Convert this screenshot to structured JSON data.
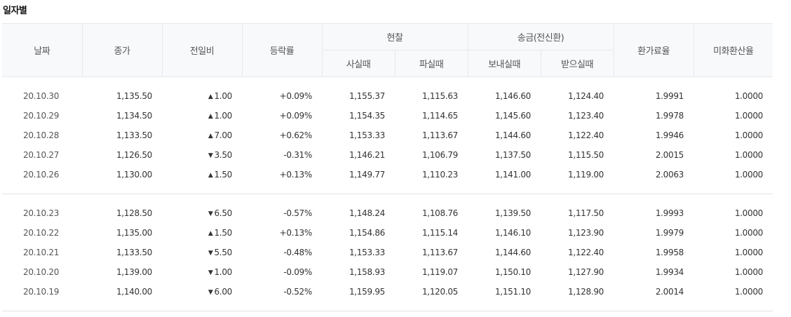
{
  "title": "일자별",
  "headers": {
    "date": "날짜",
    "close": "종가",
    "change": "전일비",
    "rate": "등락률",
    "cash": "현찰",
    "cash_buy": "사실때",
    "cash_sell": "파실때",
    "wire": "송금(전신환)",
    "wire_send": "보내실때",
    "wire_recv": "받으실때",
    "exchange_fee_rate": "환가료율",
    "usd_conversion_rate": "미화환산율"
  },
  "colors": {
    "up": "#e0242a",
    "down": "#1f57c3",
    "header_bg": "#f8f9fb"
  },
  "icons": {
    "up": "triangle-up-icon",
    "down": "triangle-down-icon"
  },
  "rows": [
    {
      "date": "20.10.30",
      "close": "1,135.50",
      "dir": "up",
      "arrow": "▲",
      "change": "1.00",
      "rate": "+0.09%",
      "cash_buy": "1,155.37",
      "cash_sell": "1,115.63",
      "wire_send": "1,146.60",
      "wire_recv": "1,124.40",
      "fee": "1.9991",
      "usd": "1.0000"
    },
    {
      "date": "20.10.29",
      "close": "1,134.50",
      "dir": "up",
      "arrow": "▲",
      "change": "1.00",
      "rate": "+0.09%",
      "cash_buy": "1,154.35",
      "cash_sell": "1,114.65",
      "wire_send": "1,145.60",
      "wire_recv": "1,123.40",
      "fee": "1.9978",
      "usd": "1.0000"
    },
    {
      "date": "20.10.28",
      "close": "1,133.50",
      "dir": "up",
      "arrow": "▲",
      "change": "7.00",
      "rate": "+0.62%",
      "cash_buy": "1,153.33",
      "cash_sell": "1,113.67",
      "wire_send": "1,144.60",
      "wire_recv": "1,122.40",
      "fee": "1.9946",
      "usd": "1.0000"
    },
    {
      "date": "20.10.27",
      "close": "1,126.50",
      "dir": "down",
      "arrow": "▼",
      "change": "3.50",
      "rate": "-0.31%",
      "cash_buy": "1,146.21",
      "cash_sell": "1,106.79",
      "wire_send": "1,137.50",
      "wire_recv": "1,115.50",
      "fee": "2.0015",
      "usd": "1.0000"
    },
    {
      "date": "20.10.26",
      "close": "1,130.00",
      "dir": "up",
      "arrow": "▲",
      "change": "1.50",
      "rate": "+0.13%",
      "cash_buy": "1,149.77",
      "cash_sell": "1,110.23",
      "wire_send": "1,141.00",
      "wire_recv": "1,119.00",
      "fee": "2.0063",
      "usd": "1.0000"
    },
    {
      "date": "20.10.23",
      "close": "1,128.50",
      "dir": "down",
      "arrow": "▼",
      "change": "6.50",
      "rate": "-0.57%",
      "cash_buy": "1,148.24",
      "cash_sell": "1,108.76",
      "wire_send": "1,139.50",
      "wire_recv": "1,117.50",
      "fee": "1.9993",
      "usd": "1.0000"
    },
    {
      "date": "20.10.22",
      "close": "1,135.00",
      "dir": "up",
      "arrow": "▲",
      "change": "1.50",
      "rate": "+0.13%",
      "cash_buy": "1,154.86",
      "cash_sell": "1,115.14",
      "wire_send": "1,146.10",
      "wire_recv": "1,123.90",
      "fee": "1.9979",
      "usd": "1.0000"
    },
    {
      "date": "20.10.21",
      "close": "1,133.50",
      "dir": "down",
      "arrow": "▼",
      "change": "5.50",
      "rate": "-0.48%",
      "cash_buy": "1,153.33",
      "cash_sell": "1,113.67",
      "wire_send": "1,144.60",
      "wire_recv": "1,122.40",
      "fee": "1.9958",
      "usd": "1.0000"
    },
    {
      "date": "20.10.20",
      "close": "1,139.00",
      "dir": "down",
      "arrow": "▼",
      "change": "1.00",
      "rate": "-0.09%",
      "cash_buy": "1,158.93",
      "cash_sell": "1,119.07",
      "wire_send": "1,150.10",
      "wire_recv": "1,127.90",
      "fee": "1.9934",
      "usd": "1.0000"
    },
    {
      "date": "20.10.19",
      "close": "1,140.00",
      "dir": "down",
      "arrow": "▼",
      "change": "6.00",
      "rate": "-0.52%",
      "cash_buy": "1,159.95",
      "cash_sell": "1,120.05",
      "wire_send": "1,151.10",
      "wire_recv": "1,128.90",
      "fee": "2.0014",
      "usd": "1.0000"
    }
  ]
}
